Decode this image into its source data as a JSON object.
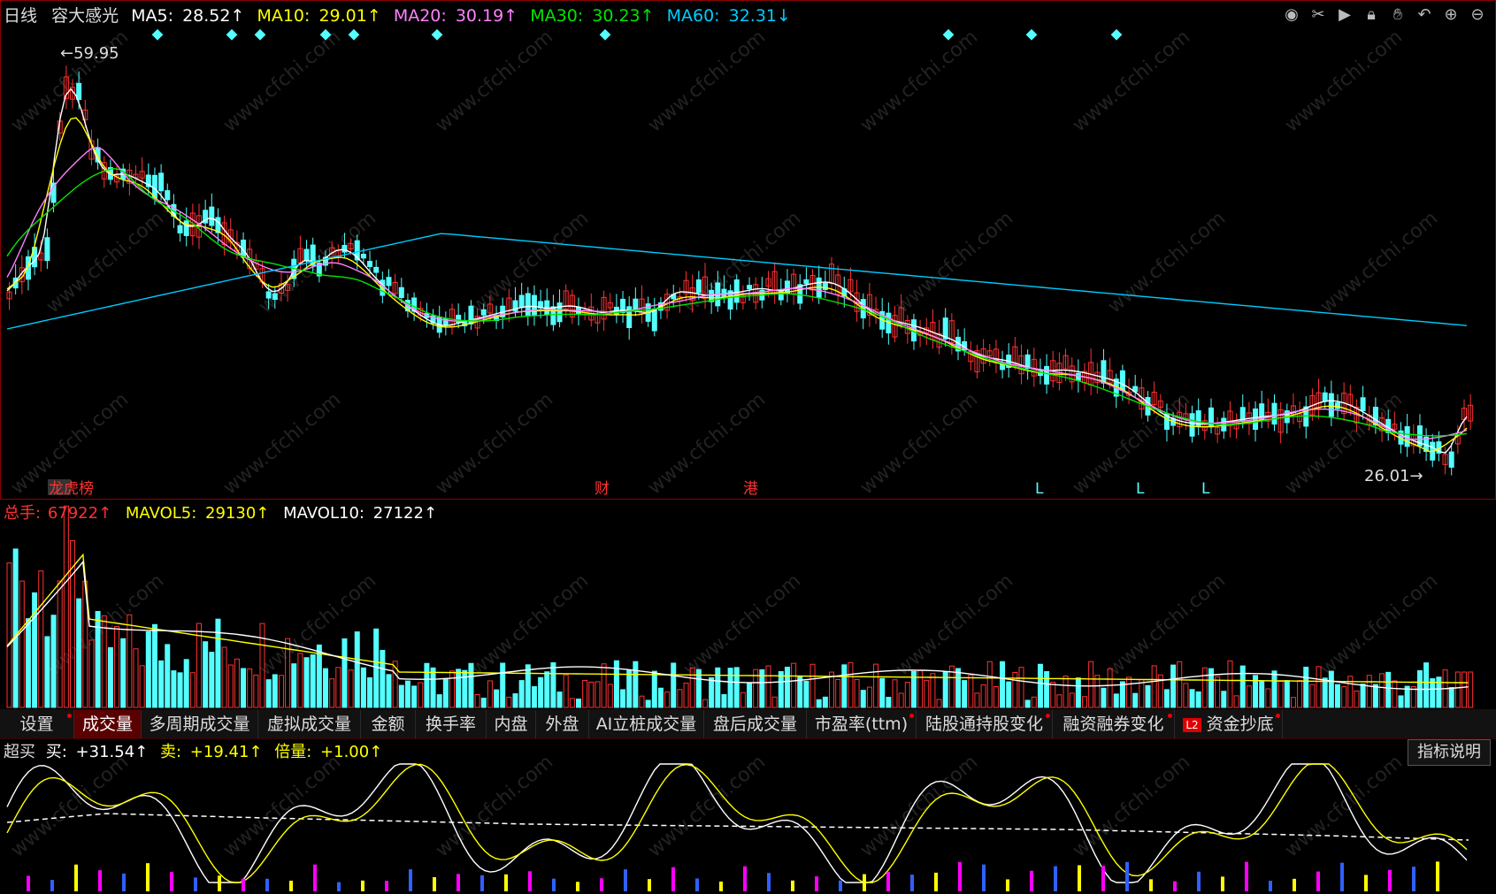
{
  "main_header": {
    "period": "日线",
    "stock": "容大感光",
    "ma5_label": "MA5:",
    "ma5_value": "28.52↑",
    "ma10_label": "MA10:",
    "ma10_value": "29.01↑",
    "ma20_label": "MA20:",
    "ma20_value": "30.19↑",
    "ma30_label": "MA30:",
    "ma30_value": "30.23↑",
    "ma60_label": "MA60:",
    "ma60_value": "32.31↓"
  },
  "annotations": {
    "high": "←59.95",
    "low": "26.01→",
    "event_markers": [
      "龙虎榜",
      "财",
      "港"
    ],
    "l_markers": [
      "L",
      "L",
      "L"
    ]
  },
  "volume_header": {
    "total_label": "总手:",
    "total_value": "67922↑",
    "mavol5_label": "MAVOL5:",
    "mavol5_value": "29130↑",
    "mavol10_label": "MAVOL10:",
    "mavol10_value": "27122↑"
  },
  "tabs": [
    {
      "label": "设置",
      "dot": true
    },
    {
      "label": "成交量",
      "dot": false,
      "active": true
    },
    {
      "label": "多周期成交量",
      "dot": false
    },
    {
      "label": "虚拟成交量",
      "dot": false
    },
    {
      "label": "金额",
      "dot": false
    },
    {
      "label": "换手率",
      "dot": false
    },
    {
      "label": "内盘",
      "dot": false
    },
    {
      "label": "外盘",
      "dot": false
    },
    {
      "label": "AI立桩成交量",
      "dot": false
    },
    {
      "label": "盘后成交量",
      "dot": false
    },
    {
      "label": "市盈率(ttm)",
      "dot": true
    },
    {
      "label": "陆股通持股变化",
      "dot": true
    },
    {
      "label": "融资融券变化",
      "dot": true
    },
    {
      "label": "资金抄底",
      "dot": true,
      "badge": "L2"
    }
  ],
  "indicator": {
    "name": "超买",
    "buy_label": "买:",
    "buy_value": "+31.54↑",
    "sell_label": "卖:",
    "sell_value": "+19.41↑",
    "ratio_label": "倍量:",
    "ratio_value": "+1.00↑",
    "explain_button": "指标说明"
  },
  "toolbar_icons": [
    "eye-icon",
    "scissors-icon",
    "play-icon",
    "lock-icon",
    "hand-icon",
    "undo-icon",
    "zoom-in-icon",
    "zoom-out-icon"
  ],
  "watermark": "www.cfchi.com",
  "colors": {
    "up": "#ff3232",
    "down": "#54ffff",
    "ma5": "#ffffff",
    "ma10": "#ffff00",
    "ma20": "#ff80ff",
    "ma30": "#00e600",
    "ma60": "#00ccff",
    "grid": "#8b0000"
  },
  "chart_data": {
    "type": "candlestick",
    "price_range": [
      26.01,
      59.95
    ],
    "ma_series": [
      "MA5",
      "MA10",
      "MA20",
      "MA30",
      "MA60"
    ],
    "last_close_label": "26.01"
  }
}
